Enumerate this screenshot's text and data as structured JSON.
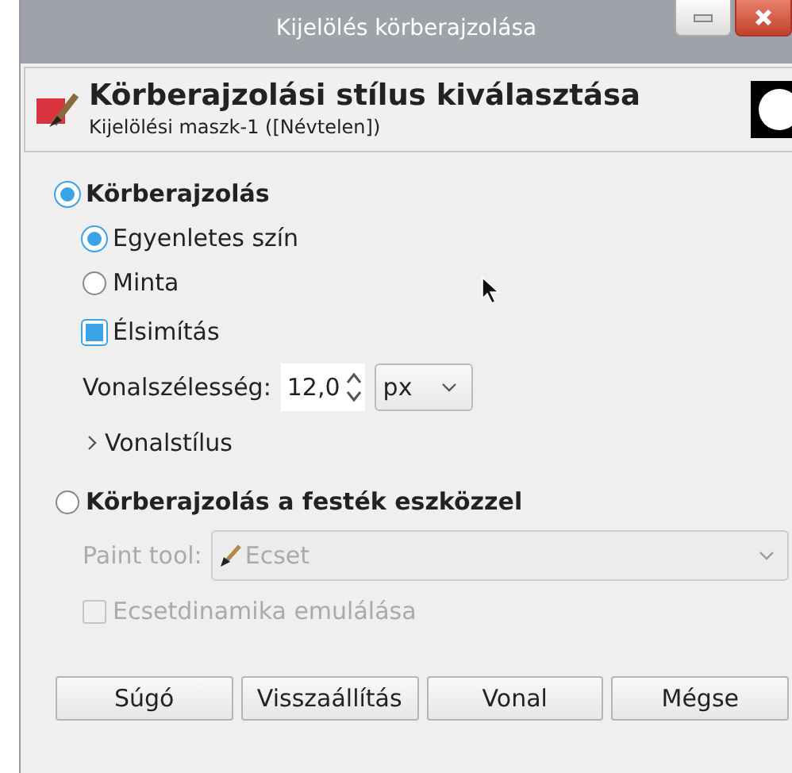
{
  "window": {
    "title": "Kijelölés körberajzolása"
  },
  "header": {
    "title": "Körberajzolási stílus kiválasztása",
    "subtitle": "Kijelölési maszk-1 ([Névtelen])"
  },
  "stroke_line": {
    "label": "Körberajzolás",
    "selected": true,
    "fill_options": [
      {
        "label": "Egyenletes szín",
        "selected": true
      },
      {
        "label": "Minta",
        "selected": false
      }
    ],
    "antialias": {
      "label": "Élsimítás",
      "checked": true
    },
    "line_width": {
      "label": "Vonalszélesség:",
      "value": "12,0",
      "unit": "px"
    },
    "line_style": {
      "label": "Vonalstílus",
      "expanded": false
    }
  },
  "stroke_paint": {
    "label": "Körberajzolás a festék eszközzel",
    "selected": false,
    "paint_tool": {
      "label": "Paint tool:",
      "value": "Ecset",
      "disabled": true
    },
    "emulate_dynamics": {
      "label": "Ecsetdinamika emulálása",
      "checked": false,
      "disabled": true
    }
  },
  "buttons": [
    "Súgó",
    "Visszaállítás",
    "Vonal",
    "Mégse"
  ]
}
